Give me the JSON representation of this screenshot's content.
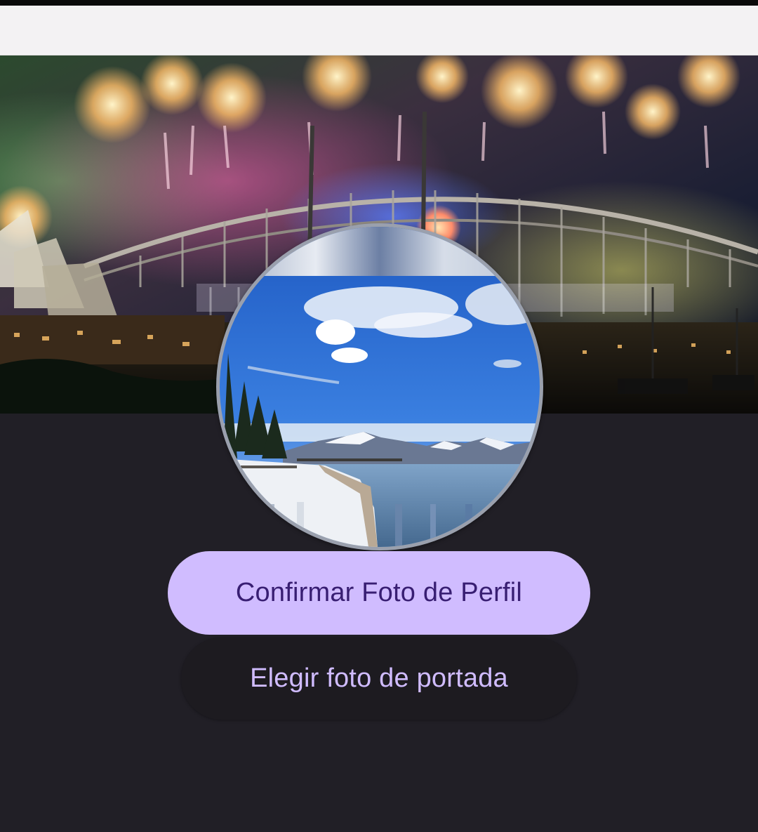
{
  "colors": {
    "background": "#211f26",
    "app_bar": "#f3f2f3",
    "primary_button_bg": "#d0bcff",
    "primary_button_text": "#381e72",
    "secondary_button_bg": "#1d1b20",
    "secondary_button_text": "#d0bcff"
  },
  "cover_photo": {
    "description_icon": "harbour-bridge-fireworks-photo"
  },
  "profile_photo": {
    "description_icon": "lake-mountains-snow-photo"
  },
  "actions": {
    "confirm_profile_label": "Confirmar Foto de Perfil",
    "choose_cover_label": "Elegir foto de portada"
  }
}
